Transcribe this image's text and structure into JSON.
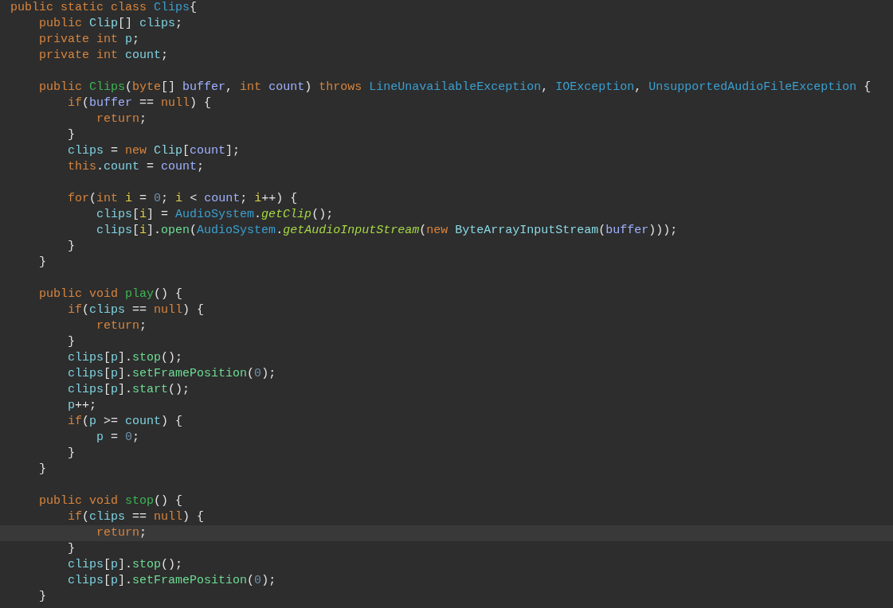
{
  "lines": [
    {
      "kind": "code",
      "current": false,
      "tokens": [
        {
          "text": "public static class ",
          "kind": "keyword"
        },
        {
          "text": "Clips",
          "kind": "class"
        },
        {
          "text": "{",
          "kind": "plain"
        }
      ],
      "children": [
        {
          "kind": "code",
          "current": false,
          "tokens": [
            {
              "text": "public ",
              "kind": "keyword"
            },
            {
              "text": "Clip",
              "kind": "type"
            },
            {
              "text": "[] ",
              "kind": "plain"
            },
            {
              "text": "clips",
              "kind": "field"
            },
            {
              "text": ";",
              "kind": "plain"
            }
          ]
        },
        {
          "kind": "code",
          "current": false,
          "tokens": [
            {
              "text": "private int ",
              "kind": "keyword"
            },
            {
              "text": "p",
              "kind": "field"
            },
            {
              "text": ";",
              "kind": "plain"
            }
          ]
        },
        {
          "kind": "code",
          "current": false,
          "tokens": [
            {
              "text": "private int ",
              "kind": "keyword"
            },
            {
              "text": "count",
              "kind": "field"
            },
            {
              "text": ";",
              "kind": "plain"
            }
          ]
        },
        {
          "kind": "blank"
        },
        {
          "kind": "code",
          "current": false,
          "tokens": [
            {
              "text": "public ",
              "kind": "keyword"
            },
            {
              "text": "Clips",
              "kind": "method-decl"
            },
            {
              "text": "(",
              "kind": "plain"
            },
            {
              "text": "byte",
              "kind": "keyword"
            },
            {
              "text": "[] ",
              "kind": "plain"
            },
            {
              "text": "buffer",
              "kind": "param"
            },
            {
              "text": ", ",
              "kind": "plain"
            },
            {
              "text": "int ",
              "kind": "keyword"
            },
            {
              "text": "count",
              "kind": "param"
            },
            {
              "text": ") ",
              "kind": "plain"
            },
            {
              "text": "throws ",
              "kind": "keyword"
            },
            {
              "text": "LineUnavailableException",
              "kind": "class"
            },
            {
              "text": ", ",
              "kind": "plain"
            },
            {
              "text": "IOException",
              "kind": "class"
            },
            {
              "text": ", ",
              "kind": "plain"
            },
            {
              "text": "UnsupportedAudioFileException",
              "kind": "class"
            },
            {
              "text": " {",
              "kind": "plain"
            }
          ],
          "children": [
            {
              "kind": "code",
              "current": false,
              "tokens": [
                {
                  "text": "if",
                  "kind": "keyword"
                },
                {
                  "text": "(",
                  "kind": "plain"
                },
                {
                  "text": "buffer",
                  "kind": "param"
                },
                {
                  "text": " == ",
                  "kind": "plain"
                },
                {
                  "text": "null",
                  "kind": "keyword"
                },
                {
                  "text": ") {",
                  "kind": "plain"
                }
              ],
              "children": [
                {
                  "kind": "code",
                  "current": false,
                  "tokens": [
                    {
                      "text": "return",
                      "kind": "keyword"
                    },
                    {
                      "text": ";",
                      "kind": "plain"
                    }
                  ]
                }
              ]
            },
            {
              "kind": "code",
              "current": false,
              "tokens": [
                {
                  "text": "}",
                  "kind": "plain"
                }
              ]
            },
            {
              "kind": "code",
              "current": false,
              "tokens": [
                {
                  "text": "clips",
                  "kind": "field"
                },
                {
                  "text": " = ",
                  "kind": "plain"
                },
                {
                  "text": "new ",
                  "kind": "keyword"
                },
                {
                  "text": "Clip",
                  "kind": "type"
                },
                {
                  "text": "[",
                  "kind": "plain"
                },
                {
                  "text": "count",
                  "kind": "param"
                },
                {
                  "text": "];",
                  "kind": "plain"
                }
              ]
            },
            {
              "kind": "code",
              "current": false,
              "tokens": [
                {
                  "text": "this",
                  "kind": "keyword"
                },
                {
                  "text": ".",
                  "kind": "plain"
                },
                {
                  "text": "count",
                  "kind": "field"
                },
                {
                  "text": " = ",
                  "kind": "plain"
                },
                {
                  "text": "count",
                  "kind": "param"
                },
                {
                  "text": ";",
                  "kind": "plain"
                }
              ]
            },
            {
              "kind": "blank"
            },
            {
              "kind": "code",
              "current": false,
              "tokens": [
                {
                  "text": "for",
                  "kind": "keyword"
                },
                {
                  "text": "(",
                  "kind": "plain"
                },
                {
                  "text": "int ",
                  "kind": "keyword"
                },
                {
                  "text": "i",
                  "kind": "local"
                },
                {
                  "text": " = ",
                  "kind": "plain"
                },
                {
                  "text": "0",
                  "kind": "number"
                },
                {
                  "text": "; ",
                  "kind": "plain"
                },
                {
                  "text": "i",
                  "kind": "local"
                },
                {
                  "text": " < ",
                  "kind": "plain"
                },
                {
                  "text": "count",
                  "kind": "param"
                },
                {
                  "text": "; ",
                  "kind": "plain"
                },
                {
                  "text": "i",
                  "kind": "local"
                },
                {
                  "text": "++) {",
                  "kind": "plain"
                }
              ],
              "children": [
                {
                  "kind": "code",
                  "current": false,
                  "tokens": [
                    {
                      "text": "clips",
                      "kind": "field"
                    },
                    {
                      "text": "[",
                      "kind": "plain"
                    },
                    {
                      "text": "i",
                      "kind": "local"
                    },
                    {
                      "text": "] = ",
                      "kind": "plain"
                    },
                    {
                      "text": "AudioSystem",
                      "kind": "class"
                    },
                    {
                      "text": ".",
                      "kind": "plain"
                    },
                    {
                      "text": "getClip",
                      "kind": "static-method"
                    },
                    {
                      "text": "();",
                      "kind": "plain"
                    }
                  ]
                },
                {
                  "kind": "code",
                  "current": false,
                  "tokens": [
                    {
                      "text": "clips",
                      "kind": "field"
                    },
                    {
                      "text": "[",
                      "kind": "plain"
                    },
                    {
                      "text": "i",
                      "kind": "local"
                    },
                    {
                      "text": "].",
                      "kind": "plain"
                    },
                    {
                      "text": "open",
                      "kind": "method"
                    },
                    {
                      "text": "(",
                      "kind": "plain"
                    },
                    {
                      "text": "AudioSystem",
                      "kind": "class"
                    },
                    {
                      "text": ".",
                      "kind": "plain"
                    },
                    {
                      "text": "getAudioInputStream",
                      "kind": "static-method"
                    },
                    {
                      "text": "(",
                      "kind": "plain"
                    },
                    {
                      "text": "new ",
                      "kind": "keyword"
                    },
                    {
                      "text": "ByteArrayInputStream",
                      "kind": "type"
                    },
                    {
                      "text": "(",
                      "kind": "plain"
                    },
                    {
                      "text": "buffer",
                      "kind": "param"
                    },
                    {
                      "text": ")));",
                      "kind": "plain"
                    }
                  ]
                }
              ]
            },
            {
              "kind": "code",
              "current": false,
              "tokens": [
                {
                  "text": "}",
                  "kind": "plain"
                }
              ]
            }
          ]
        },
        {
          "kind": "code",
          "current": false,
          "tokens": [
            {
              "text": "}",
              "kind": "plain"
            }
          ]
        },
        {
          "kind": "blank"
        },
        {
          "kind": "code",
          "current": false,
          "tokens": [
            {
              "text": "public void ",
              "kind": "keyword"
            },
            {
              "text": "play",
              "kind": "method-decl"
            },
            {
              "text": "() {",
              "kind": "plain"
            }
          ],
          "children": [
            {
              "kind": "code",
              "current": false,
              "tokens": [
                {
                  "text": "if",
                  "kind": "keyword"
                },
                {
                  "text": "(",
                  "kind": "plain"
                },
                {
                  "text": "clips",
                  "kind": "field"
                },
                {
                  "text": " == ",
                  "kind": "plain"
                },
                {
                  "text": "null",
                  "kind": "keyword"
                },
                {
                  "text": ") {",
                  "kind": "plain"
                }
              ],
              "children": [
                {
                  "kind": "code",
                  "current": false,
                  "tokens": [
                    {
                      "text": "return",
                      "kind": "keyword"
                    },
                    {
                      "text": ";",
                      "kind": "plain"
                    }
                  ]
                }
              ]
            },
            {
              "kind": "code",
              "current": false,
              "tokens": [
                {
                  "text": "}",
                  "kind": "plain"
                }
              ]
            },
            {
              "kind": "code",
              "current": false,
              "tokens": [
                {
                  "text": "clips",
                  "kind": "field"
                },
                {
                  "text": "[",
                  "kind": "plain"
                },
                {
                  "text": "p",
                  "kind": "field"
                },
                {
                  "text": "].",
                  "kind": "plain"
                },
                {
                  "text": "stop",
                  "kind": "method"
                },
                {
                  "text": "();",
                  "kind": "plain"
                }
              ]
            },
            {
              "kind": "code",
              "current": false,
              "tokens": [
                {
                  "text": "clips",
                  "kind": "field"
                },
                {
                  "text": "[",
                  "kind": "plain"
                },
                {
                  "text": "p",
                  "kind": "field"
                },
                {
                  "text": "].",
                  "kind": "plain"
                },
                {
                  "text": "setFramePosition",
                  "kind": "method"
                },
                {
                  "text": "(",
                  "kind": "plain"
                },
                {
                  "text": "0",
                  "kind": "number"
                },
                {
                  "text": ");",
                  "kind": "plain"
                }
              ]
            },
            {
              "kind": "code",
              "current": false,
              "tokens": [
                {
                  "text": "clips",
                  "kind": "field"
                },
                {
                  "text": "[",
                  "kind": "plain"
                },
                {
                  "text": "p",
                  "kind": "field"
                },
                {
                  "text": "].",
                  "kind": "plain"
                },
                {
                  "text": "start",
                  "kind": "method"
                },
                {
                  "text": "();",
                  "kind": "plain"
                }
              ]
            },
            {
              "kind": "code",
              "current": false,
              "tokens": [
                {
                  "text": "p",
                  "kind": "field"
                },
                {
                  "text": "++;",
                  "kind": "plain"
                }
              ]
            },
            {
              "kind": "code",
              "current": false,
              "tokens": [
                {
                  "text": "if",
                  "kind": "keyword"
                },
                {
                  "text": "(",
                  "kind": "plain"
                },
                {
                  "text": "p",
                  "kind": "field"
                },
                {
                  "text": " >= ",
                  "kind": "plain"
                },
                {
                  "text": "count",
                  "kind": "field"
                },
                {
                  "text": ") {",
                  "kind": "plain"
                }
              ],
              "children": [
                {
                  "kind": "code",
                  "current": false,
                  "tokens": [
                    {
                      "text": "p",
                      "kind": "field"
                    },
                    {
                      "text": " = ",
                      "kind": "plain"
                    },
                    {
                      "text": "0",
                      "kind": "number"
                    },
                    {
                      "text": ";",
                      "kind": "plain"
                    }
                  ]
                }
              ]
            },
            {
              "kind": "code",
              "current": false,
              "tokens": [
                {
                  "text": "}",
                  "kind": "plain"
                }
              ]
            }
          ]
        },
        {
          "kind": "code",
          "current": false,
          "tokens": [
            {
              "text": "}",
              "kind": "plain"
            }
          ]
        },
        {
          "kind": "blank"
        },
        {
          "kind": "code",
          "current": false,
          "tokens": [
            {
              "text": "public void ",
              "kind": "keyword"
            },
            {
              "text": "stop",
              "kind": "method-decl"
            },
            {
              "text": "() {",
              "kind": "plain"
            }
          ],
          "children": [
            {
              "kind": "code",
              "current": false,
              "tokens": [
                {
                  "text": "if",
                  "kind": "keyword"
                },
                {
                  "text": "(",
                  "kind": "plain"
                },
                {
                  "text": "clips",
                  "kind": "field"
                },
                {
                  "text": " == ",
                  "kind": "plain"
                },
                {
                  "text": "null",
                  "kind": "keyword"
                },
                {
                  "text": ") {",
                  "kind": "plain"
                }
              ],
              "children": [
                {
                  "kind": "code",
                  "current": true,
                  "tokens": [
                    {
                      "text": "return",
                      "kind": "keyword"
                    },
                    {
                      "text": ";",
                      "kind": "plain"
                    }
                  ]
                }
              ]
            },
            {
              "kind": "code",
              "current": false,
              "tokens": [
                {
                  "text": "}",
                  "kind": "plain"
                }
              ]
            },
            {
              "kind": "code",
              "current": false,
              "tokens": [
                {
                  "text": "clips",
                  "kind": "field"
                },
                {
                  "text": "[",
                  "kind": "plain"
                },
                {
                  "text": "p",
                  "kind": "field"
                },
                {
                  "text": "].",
                  "kind": "plain"
                },
                {
                  "text": "stop",
                  "kind": "method"
                },
                {
                  "text": "();",
                  "kind": "plain"
                }
              ]
            },
            {
              "kind": "code",
              "current": false,
              "tokens": [
                {
                  "text": "clips",
                  "kind": "field"
                },
                {
                  "text": "[",
                  "kind": "plain"
                },
                {
                  "text": "p",
                  "kind": "field"
                },
                {
                  "text": "].",
                  "kind": "plain"
                },
                {
                  "text": "setFramePosition",
                  "kind": "method"
                },
                {
                  "text": "(",
                  "kind": "plain"
                },
                {
                  "text": "0",
                  "kind": "number"
                },
                {
                  "text": ");",
                  "kind": "plain"
                }
              ]
            }
          ]
        },
        {
          "kind": "code",
          "current": false,
          "tokens": [
            {
              "text": "}",
              "kind": "plain"
            }
          ]
        }
      ]
    }
  ]
}
